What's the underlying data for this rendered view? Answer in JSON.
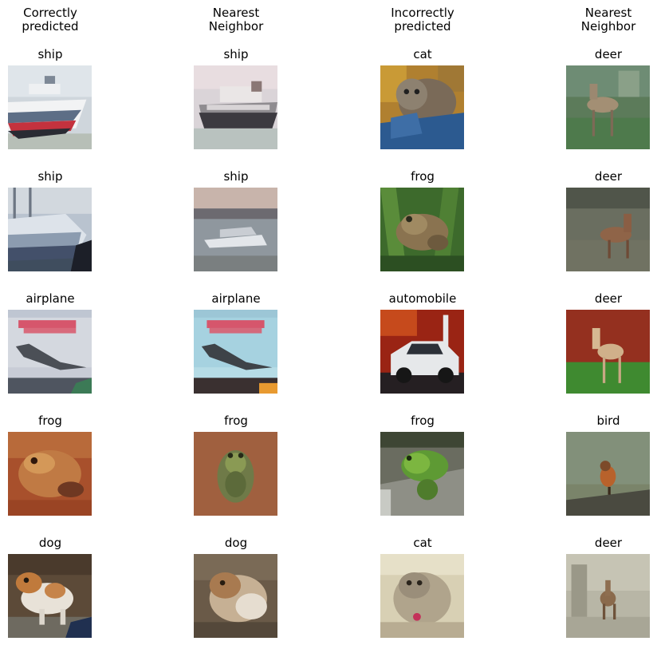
{
  "columns": [
    {
      "line1": "Correctly",
      "line2": "predicted"
    },
    {
      "line1": "Nearest",
      "line2": "Neighbor"
    },
    {
      "line1": "Incorrectly",
      "line2": "predicted"
    },
    {
      "line1": "Nearest",
      "line2": "Neighbor"
    }
  ],
  "rows": [
    {
      "labels": [
        "ship",
        "ship",
        "cat",
        "deer"
      ]
    },
    {
      "labels": [
        "ship",
        "ship",
        "frog",
        "deer"
      ]
    },
    {
      "labels": [
        "airplane",
        "airplane",
        "automobile",
        "deer"
      ]
    },
    {
      "labels": [
        "frog",
        "frog",
        "frog",
        "bird"
      ]
    },
    {
      "labels": [
        "dog",
        "dog",
        "cat",
        "deer"
      ]
    }
  ]
}
